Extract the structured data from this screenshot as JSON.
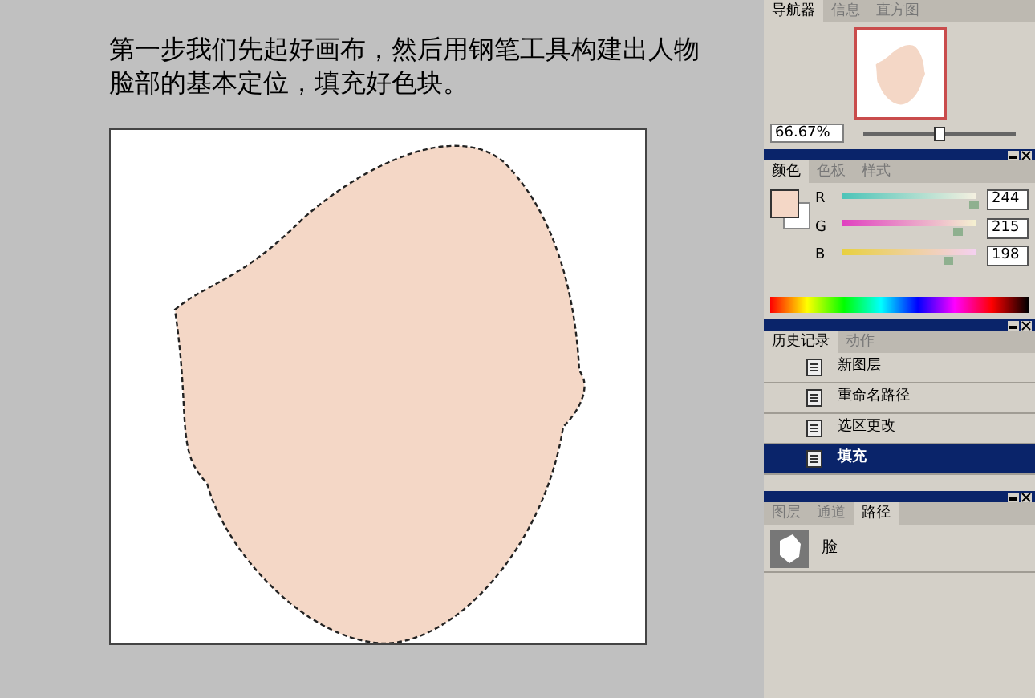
{
  "instruction": "第一步我们先起好画布，然后用钢笔工具构建出人物脸部的基本定位，填充好色块。",
  "navigator": {
    "tabs": [
      {
        "label": "导航器",
        "selected": true
      },
      {
        "label": "信息",
        "selected": false
      },
      {
        "label": "直方图",
        "selected": false
      }
    ],
    "zoom": "66.67%",
    "zoom_slider": {
      "level": 0.5
    }
  },
  "color": {
    "tabs": [
      {
        "label": "颜色",
        "selected": true
      },
      {
        "label": "色板",
        "selected": false
      },
      {
        "label": "样式",
        "selected": false
      }
    ],
    "channels": [
      {
        "name": "R",
        "value": "244",
        "level": 0.96
      },
      {
        "name": "G",
        "value": "215",
        "level": 0.84
      },
      {
        "name": "B",
        "value": "198",
        "level": 0.78
      }
    ]
  },
  "history": {
    "tabs": [
      {
        "label": "历史记录",
        "selected": true
      },
      {
        "label": "动作",
        "selected": false
      }
    ],
    "items": [
      {
        "label": "新图层",
        "selected": false
      },
      {
        "label": "重命名路径",
        "selected": false
      },
      {
        "label": "选区更改",
        "selected": false
      },
      {
        "label": "填充",
        "selected": true
      }
    ]
  },
  "paths": {
    "tabs": [
      {
        "label": "图层",
        "selected": false
      },
      {
        "label": "通道",
        "selected": false
      },
      {
        "label": "路径",
        "selected": true
      }
    ],
    "items": [
      {
        "label": "脸",
        "selected": false
      }
    ]
  }
}
